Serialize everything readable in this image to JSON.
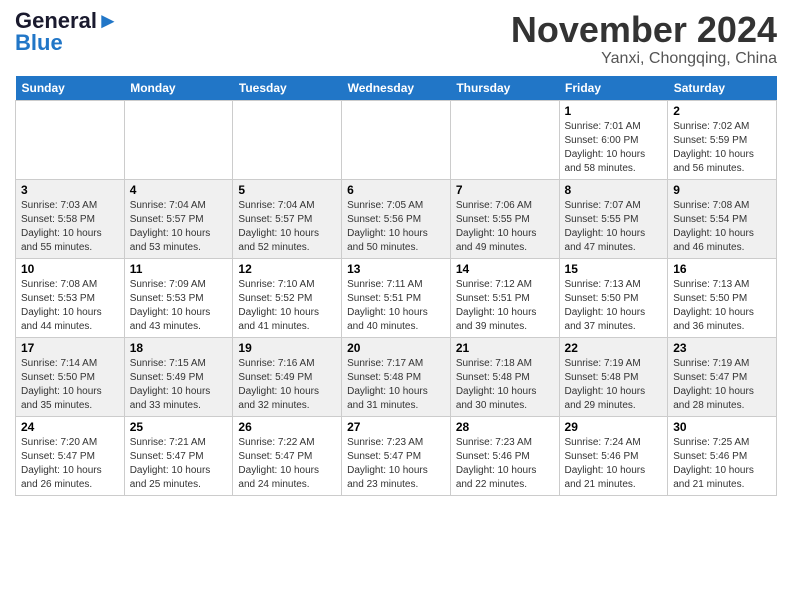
{
  "header": {
    "logo_line1": "General",
    "logo_line2": "Blue",
    "month_title": "November 2024",
    "location": "Yanxi, Chongqing, China"
  },
  "weekdays": [
    "Sunday",
    "Monday",
    "Tuesday",
    "Wednesday",
    "Thursday",
    "Friday",
    "Saturday"
  ],
  "weeks": [
    [
      {
        "day": "",
        "info": ""
      },
      {
        "day": "",
        "info": ""
      },
      {
        "day": "",
        "info": ""
      },
      {
        "day": "",
        "info": ""
      },
      {
        "day": "",
        "info": ""
      },
      {
        "day": "1",
        "info": "Sunrise: 7:01 AM\nSunset: 6:00 PM\nDaylight: 10 hours\nand 58 minutes."
      },
      {
        "day": "2",
        "info": "Sunrise: 7:02 AM\nSunset: 5:59 PM\nDaylight: 10 hours\nand 56 minutes."
      }
    ],
    [
      {
        "day": "3",
        "info": "Sunrise: 7:03 AM\nSunset: 5:58 PM\nDaylight: 10 hours\nand 55 minutes."
      },
      {
        "day": "4",
        "info": "Sunrise: 7:04 AM\nSunset: 5:57 PM\nDaylight: 10 hours\nand 53 minutes."
      },
      {
        "day": "5",
        "info": "Sunrise: 7:04 AM\nSunset: 5:57 PM\nDaylight: 10 hours\nand 52 minutes."
      },
      {
        "day": "6",
        "info": "Sunrise: 7:05 AM\nSunset: 5:56 PM\nDaylight: 10 hours\nand 50 minutes."
      },
      {
        "day": "7",
        "info": "Sunrise: 7:06 AM\nSunset: 5:55 PM\nDaylight: 10 hours\nand 49 minutes."
      },
      {
        "day": "8",
        "info": "Sunrise: 7:07 AM\nSunset: 5:55 PM\nDaylight: 10 hours\nand 47 minutes."
      },
      {
        "day": "9",
        "info": "Sunrise: 7:08 AM\nSunset: 5:54 PM\nDaylight: 10 hours\nand 46 minutes."
      }
    ],
    [
      {
        "day": "10",
        "info": "Sunrise: 7:08 AM\nSunset: 5:53 PM\nDaylight: 10 hours\nand 44 minutes."
      },
      {
        "day": "11",
        "info": "Sunrise: 7:09 AM\nSunset: 5:53 PM\nDaylight: 10 hours\nand 43 minutes."
      },
      {
        "day": "12",
        "info": "Sunrise: 7:10 AM\nSunset: 5:52 PM\nDaylight: 10 hours\nand 41 minutes."
      },
      {
        "day": "13",
        "info": "Sunrise: 7:11 AM\nSunset: 5:51 PM\nDaylight: 10 hours\nand 40 minutes."
      },
      {
        "day": "14",
        "info": "Sunrise: 7:12 AM\nSunset: 5:51 PM\nDaylight: 10 hours\nand 39 minutes."
      },
      {
        "day": "15",
        "info": "Sunrise: 7:13 AM\nSunset: 5:50 PM\nDaylight: 10 hours\nand 37 minutes."
      },
      {
        "day": "16",
        "info": "Sunrise: 7:13 AM\nSunset: 5:50 PM\nDaylight: 10 hours\nand 36 minutes."
      }
    ],
    [
      {
        "day": "17",
        "info": "Sunrise: 7:14 AM\nSunset: 5:50 PM\nDaylight: 10 hours\nand 35 minutes."
      },
      {
        "day": "18",
        "info": "Sunrise: 7:15 AM\nSunset: 5:49 PM\nDaylight: 10 hours\nand 33 minutes."
      },
      {
        "day": "19",
        "info": "Sunrise: 7:16 AM\nSunset: 5:49 PM\nDaylight: 10 hours\nand 32 minutes."
      },
      {
        "day": "20",
        "info": "Sunrise: 7:17 AM\nSunset: 5:48 PM\nDaylight: 10 hours\nand 31 minutes."
      },
      {
        "day": "21",
        "info": "Sunrise: 7:18 AM\nSunset: 5:48 PM\nDaylight: 10 hours\nand 30 minutes."
      },
      {
        "day": "22",
        "info": "Sunrise: 7:19 AM\nSunset: 5:48 PM\nDaylight: 10 hours\nand 29 minutes."
      },
      {
        "day": "23",
        "info": "Sunrise: 7:19 AM\nSunset: 5:47 PM\nDaylight: 10 hours\nand 28 minutes."
      }
    ],
    [
      {
        "day": "24",
        "info": "Sunrise: 7:20 AM\nSunset: 5:47 PM\nDaylight: 10 hours\nand 26 minutes."
      },
      {
        "day": "25",
        "info": "Sunrise: 7:21 AM\nSunset: 5:47 PM\nDaylight: 10 hours\nand 25 minutes."
      },
      {
        "day": "26",
        "info": "Sunrise: 7:22 AM\nSunset: 5:47 PM\nDaylight: 10 hours\nand 24 minutes."
      },
      {
        "day": "27",
        "info": "Sunrise: 7:23 AM\nSunset: 5:47 PM\nDaylight: 10 hours\nand 23 minutes."
      },
      {
        "day": "28",
        "info": "Sunrise: 7:23 AM\nSunset: 5:46 PM\nDaylight: 10 hours\nand 22 minutes."
      },
      {
        "day": "29",
        "info": "Sunrise: 7:24 AM\nSunset: 5:46 PM\nDaylight: 10 hours\nand 21 minutes."
      },
      {
        "day": "30",
        "info": "Sunrise: 7:25 AM\nSunset: 5:46 PM\nDaylight: 10 hours\nand 21 minutes."
      }
    ]
  ]
}
